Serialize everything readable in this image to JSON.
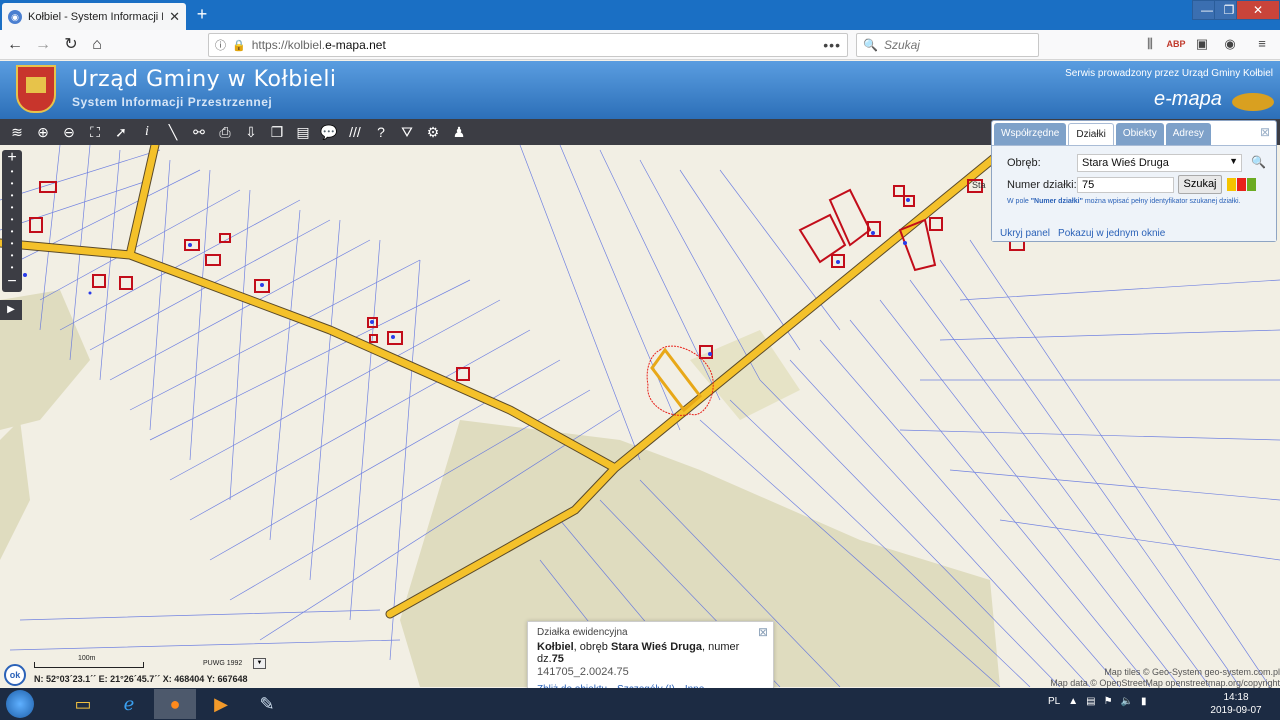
{
  "browser": {
    "tab_title": "Kołbiel - System Informacji Prz",
    "url_prefix": "https://kolbiel.",
    "url_domain": "e-mapa.net",
    "search_placeholder": "Szukaj",
    "win_min": "—",
    "win_max": "❐",
    "win_close": "✕"
  },
  "site": {
    "title": "Urząd Gminy w Kołbieli",
    "subtitle": "System Informacji Przestrzennej",
    "service_note": "Serwis prowadzony przez Urząd Gminy Kołbiel",
    "brand": "e-mapa"
  },
  "panel": {
    "tabs": [
      "Współrzędne",
      "Działki",
      "Obiekty",
      "Adresy"
    ],
    "active_tab": "Działki",
    "obreb_label": "Obręb:",
    "obreb_value": "Stara Wieś Druga",
    "numer_label": "Numer działki:",
    "numer_value": "75",
    "search_button": "Szukaj",
    "hint_pre": "W pole ",
    "hint_bold": "\"Numer działki\"",
    "hint_post": " można wpisać pełny identyfikator szukanej działki.",
    "link_hide": "Ukryj panel",
    "link_single": "Pokazuj w jednym oknie",
    "swatch_colors": [
      "#f5c400",
      "#e8221b",
      "#6bab22"
    ]
  },
  "popup": {
    "title": "Działka ewidencyjna",
    "place": "Kołbiel",
    "obreb_text": ", obręb ",
    "obreb": "Stara Wieś Druga",
    "numer_text": ", numer dz.",
    "numer": "75",
    "id": "141705_2.0024.75",
    "link_zoom": "Zbliż do obiektu",
    "link_details": "Szczegóły (I)",
    "link_other": "Inne"
  },
  "status": {
    "ok": "ok",
    "scale": "100m",
    "crs": "PUWG 1992",
    "coords": "N: 52°03´23.1´´ E: 21°26´45.7´´  X: 468404     Y: 667648"
  },
  "attribution": {
    "line1": "Map tiles © Geo-System geo-system.com.pl",
    "line2": "Map data © OpenStreetMap openstreetmap.org/copyright"
  },
  "taskbar": {
    "lang": "PL",
    "time": "14:18",
    "date": "2019-09-07"
  }
}
